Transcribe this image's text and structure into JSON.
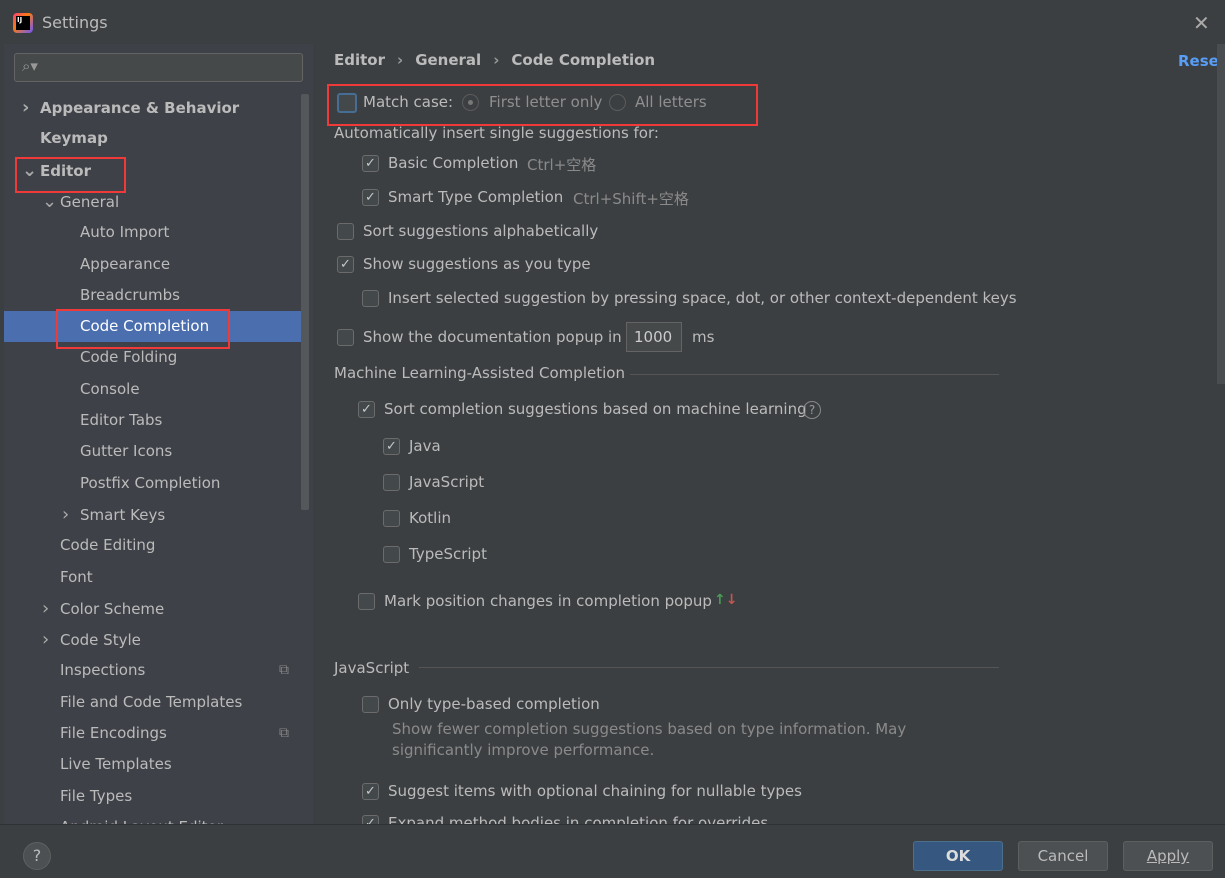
{
  "window": {
    "title": "Settings",
    "icon": "intellij-logo-icon"
  },
  "search": {
    "placeholder": "",
    "icon": "search-icon"
  },
  "sidebar": {
    "items": [
      {
        "label": "Appearance & Behavior",
        "bold": true,
        "chevron": "right"
      },
      {
        "label": "Keymap",
        "bold": true
      },
      {
        "label": "Editor",
        "bold": true,
        "chevron": "down"
      },
      {
        "label": "General",
        "chevron": "down"
      },
      {
        "label": "Auto Import"
      },
      {
        "label": "Appearance"
      },
      {
        "label": "Breadcrumbs"
      },
      {
        "label": "Code Completion",
        "selected": true
      },
      {
        "label": "Code Folding"
      },
      {
        "label": "Console"
      },
      {
        "label": "Editor Tabs"
      },
      {
        "label": "Gutter Icons"
      },
      {
        "label": "Postfix Completion"
      },
      {
        "label": "Smart Keys",
        "chevron": "right"
      },
      {
        "label": "Code Editing"
      },
      {
        "label": "Font"
      },
      {
        "label": "Color Scheme",
        "chevron": "right"
      },
      {
        "label": "Code Style",
        "chevron": "right"
      },
      {
        "label": "Inspections",
        "badge": "copy-icon"
      },
      {
        "label": "File and Code Templates"
      },
      {
        "label": "File Encodings",
        "badge": "copy-icon"
      },
      {
        "label": "Live Templates"
      },
      {
        "label": "File Types"
      },
      {
        "label": "Android Layout Editor"
      }
    ]
  },
  "breadcrumb": [
    "Editor",
    "General",
    "Code Completion"
  ],
  "reset_label": "Reset",
  "content": {
    "match_case": {
      "label": "Match case:",
      "checked": false,
      "options": [
        "First letter only",
        "All letters"
      ],
      "selected": "First letter only"
    },
    "auto_insert_heading": "Automatically insert single suggestions for:",
    "basic": {
      "label": "Basic Completion",
      "shortcut": "Ctrl+空格",
      "checked": true
    },
    "smart": {
      "label": "Smart Type Completion",
      "shortcut": "Ctrl+Shift+空格",
      "checked": true
    },
    "sort_alpha": {
      "label": "Sort suggestions alphabetically",
      "checked": false
    },
    "show_as_type": {
      "label": "Show suggestions as you type",
      "checked": true
    },
    "insert_selected": {
      "label": "Insert selected suggestion by pressing space, dot, or other context-dependent keys",
      "checked": false
    },
    "doc_popup": {
      "label": "Show the documentation popup in",
      "value": "1000",
      "unit": "ms",
      "checked": false
    },
    "ml_heading": "Machine Learning-Assisted Completion",
    "ml_sort": {
      "label": "Sort completion suggestions based on machine learning",
      "checked": true
    },
    "ml_langs": [
      {
        "label": "Java",
        "checked": true
      },
      {
        "label": "JavaScript",
        "checked": false
      },
      {
        "label": "Kotlin",
        "checked": false
      },
      {
        "label": "TypeScript",
        "checked": false
      }
    ],
    "mark_pos": {
      "label": "Mark position changes in completion popup",
      "checked": false
    },
    "js_heading": "JavaScript",
    "type_based": {
      "label": "Only type-based completion",
      "checked": false,
      "desc1": "Show fewer completion suggestions based on type information. May",
      "desc2": "significantly improve performance."
    },
    "optional_chain": {
      "label": "Suggest items with optional chaining for nullable types",
      "checked": true
    },
    "expand_bodies": {
      "label": "Expand method bodies in completion for overrides",
      "checked": true
    }
  },
  "footer": {
    "help": "?",
    "ok": "OK",
    "cancel": "Cancel",
    "apply": "Apply"
  },
  "colors": {
    "accent": "#4b6eaf",
    "link": "#589df6",
    "highlight": "#f03a3a"
  }
}
